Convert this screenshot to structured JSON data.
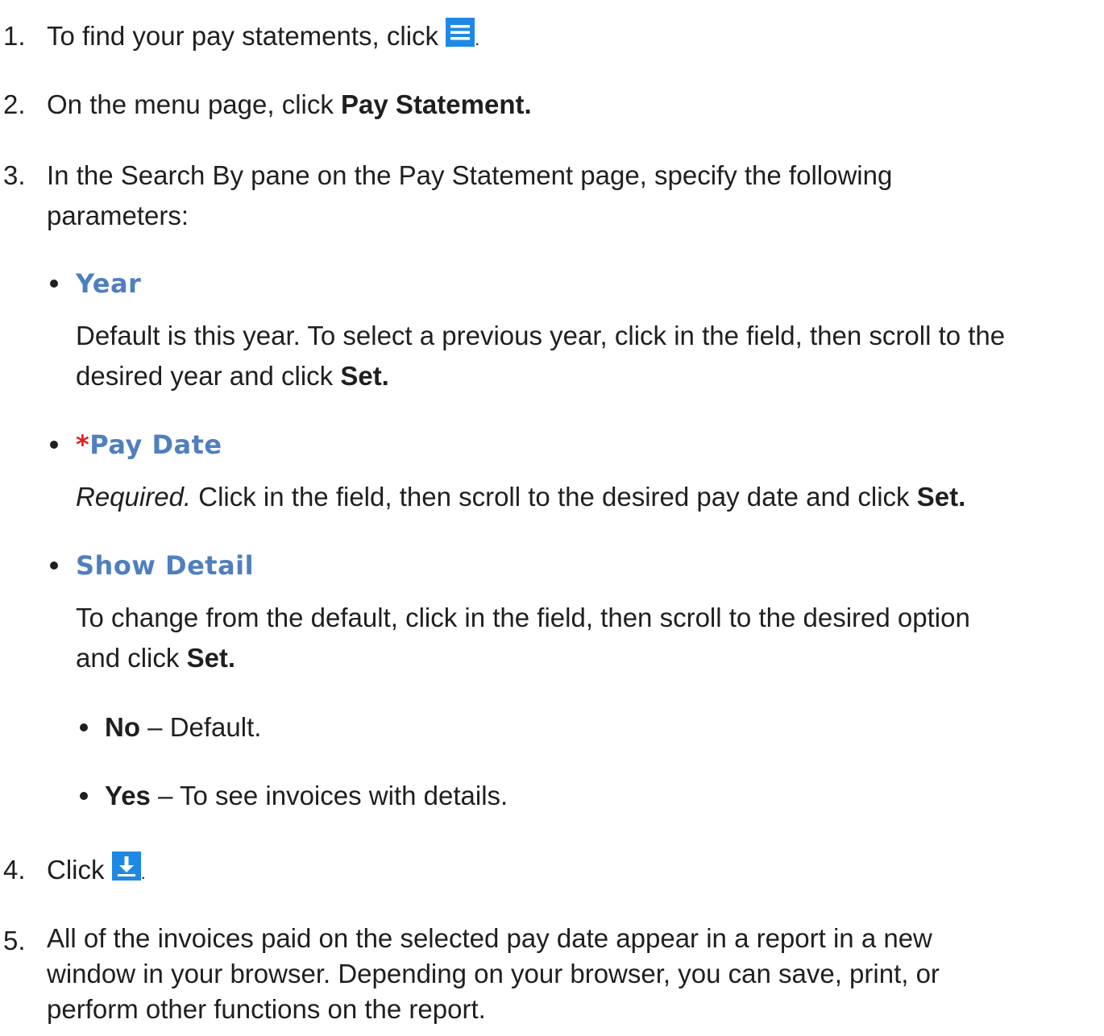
{
  "steps": [
    {
      "num": "1.",
      "text": "To find your pay statements, click",
      "icon": "menu-icon",
      "suffix": "."
    },
    {
      "num": "2.",
      "text": "On the menu page, click",
      "bold": "Pay Statement."
    },
    {
      "num": "3.",
      "text_line1": "In the Search By pane on the Pay Statement page, specify the following",
      "text_line2": "parameters:"
    },
    {
      "num": "4.",
      "text": "Click",
      "icon": "download-icon",
      "suffix": "."
    },
    {
      "num": "5.",
      "text_line1": "All of the invoices paid on the selected pay date appear in a report in a new",
      "text_line2": "window in your browser. Depending on your browser, you can save, print, or",
      "text_line3": "perform other functions on the report."
    }
  ],
  "parameters": [
    {
      "title": "Year",
      "desc_line1": "Default is this year. To select a previous year, click in the field, then scroll to the",
      "desc_line2": "desired year and click",
      "desc_bold": "Set."
    },
    {
      "required_mark": "*",
      "title": "Pay Date",
      "desc_italic": "Required.",
      "desc_text": " Click in the field, then scroll to the desired pay date and click",
      "desc_bold": "Set."
    },
    {
      "title": "Show Detail",
      "desc_line1": "To change from the default, click in the field, then scroll to the desired option",
      "desc_line2": "and click",
      "desc_bold": "Set."
    }
  ],
  "show_detail_options": [
    {
      "label": "No",
      "desc": " – Default."
    },
    {
      "label": "Yes",
      "desc": " – To see invoices with details."
    }
  ],
  "colors": {
    "icon_blue": "#1e88e5",
    "param_title": "#4f7fbf",
    "required_red": "#e02020"
  }
}
